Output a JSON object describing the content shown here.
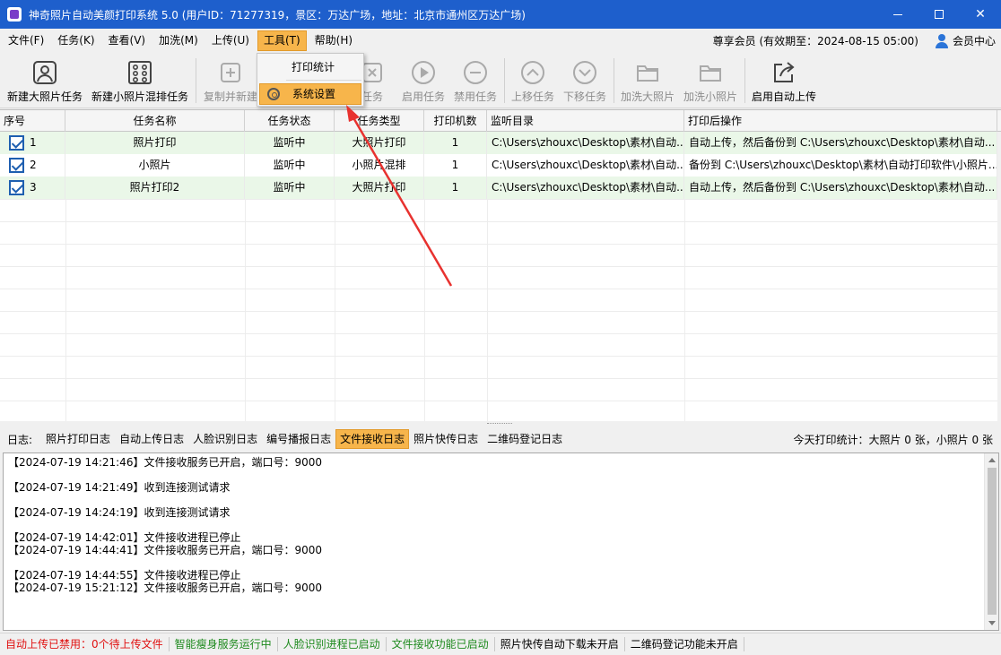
{
  "window": {
    "title": "神奇照片自动美颜打印系统 5.0 (用户ID：71277319，景区：万达广场，地址：北京市通州区万达广场)",
    "minimize": "—",
    "maximize": "☐",
    "close": "✕"
  },
  "menu": {
    "items": [
      "文件(F)",
      "任务(K)",
      "查看(V)",
      "加洗(M)",
      "上传(U)",
      "工具(T)",
      "帮助(H)"
    ],
    "active_index": 5,
    "member_info": "尊享会员 (有效期至：2024-08-15 05:00)",
    "member_center": "会员中心"
  },
  "toolbar": {
    "new_large": "新建大照片任务",
    "new_small": "新建小照片混排任务",
    "copy_new": "复制并新建",
    "delete": "任务",
    "enable": "启用任务",
    "disable": "禁用任务",
    "move_up": "上移任务",
    "move_down": "下移任务",
    "add_large": "加洗大照片",
    "add_small": "加洗小照片",
    "auto_upload": "启用自动上传"
  },
  "dropdown": {
    "items": [
      "打印统计",
      "系统设置"
    ],
    "highlighted_index": 1
  },
  "table": {
    "headers": [
      "序号",
      "任务名称",
      "任务状态",
      "任务类型",
      "打印机数",
      "监听目录",
      "打印后操作"
    ],
    "rows": [
      {
        "checked": true,
        "no": "1",
        "name": "照片打印",
        "status": "监听中",
        "type": "大照片打印",
        "printers": "1",
        "dir": "C:\\Users\\zhouxc\\Desktop\\素材\\自动...",
        "after": "自动上传，然后备份到 C:\\Users\\zhouxc\\Desktop\\素材\\自动..."
      },
      {
        "checked": true,
        "no": "2",
        "name": "小照片",
        "status": "监听中",
        "type": "小照片混排",
        "printers": "1",
        "dir": "C:\\Users\\zhouxc\\Desktop\\素材\\自动...",
        "after": "备份到 C:\\Users\\zhouxc\\Desktop\\素材\\自动打印软件\\小照片..."
      },
      {
        "checked": true,
        "no": "3",
        "name": "照片打印2",
        "status": "监听中",
        "type": "大照片打印",
        "printers": "1",
        "dir": "C:\\Users\\zhouxc\\Desktop\\素材\\自动...",
        "after": "自动上传，然后备份到 C:\\Users\\zhouxc\\Desktop\\素材\\自动..."
      }
    ]
  },
  "logs": {
    "label": "日志:",
    "tabs": [
      "照片打印日志",
      "自动上传日志",
      "人脸识别日志",
      "编号播报日志",
      "文件接收日志",
      "照片快传日志",
      "二维码登记日志"
    ],
    "active_index": 4,
    "today_stats": "今天打印统计：大照片 0 张，小照片 0 张",
    "lines": [
      "【2024-07-19 14:21:46】文件接收服务已开启，端口号：9000",
      "",
      "【2024-07-19 14:21:49】收到连接测试请求",
      "",
      "【2024-07-19 14:24:19】收到连接测试请求",
      "",
      "【2024-07-19 14:42:01】文件接收进程已停止",
      "【2024-07-19 14:44:41】文件接收服务已开启，端口号：9000",
      "",
      "【2024-07-19 14:44:55】文件接收进程已停止",
      "【2024-07-19 15:21:12】文件接收服务已开启，端口号：9000"
    ]
  },
  "status": {
    "items": [
      {
        "text": "自动上传已禁用：0个待上传文件",
        "color": "#e01010"
      },
      {
        "text": "智能瘦身服务运行中",
        "color": "#1e8a1e"
      },
      {
        "text": "人脸识别进程已启动",
        "color": "#1e8a1e"
      },
      {
        "text": "文件接收功能已启动",
        "color": "#1e8a1e"
      },
      {
        "text": "照片快传自动下载未开启",
        "color": "#000000"
      },
      {
        "text": "二维码登记功能未开启",
        "color": "#000000"
      }
    ]
  },
  "colors": {
    "titlebar": "#1e5fcc",
    "highlight": "#f7b54b",
    "row_green": "#eaf7e8",
    "arrow": "#e8322f"
  }
}
